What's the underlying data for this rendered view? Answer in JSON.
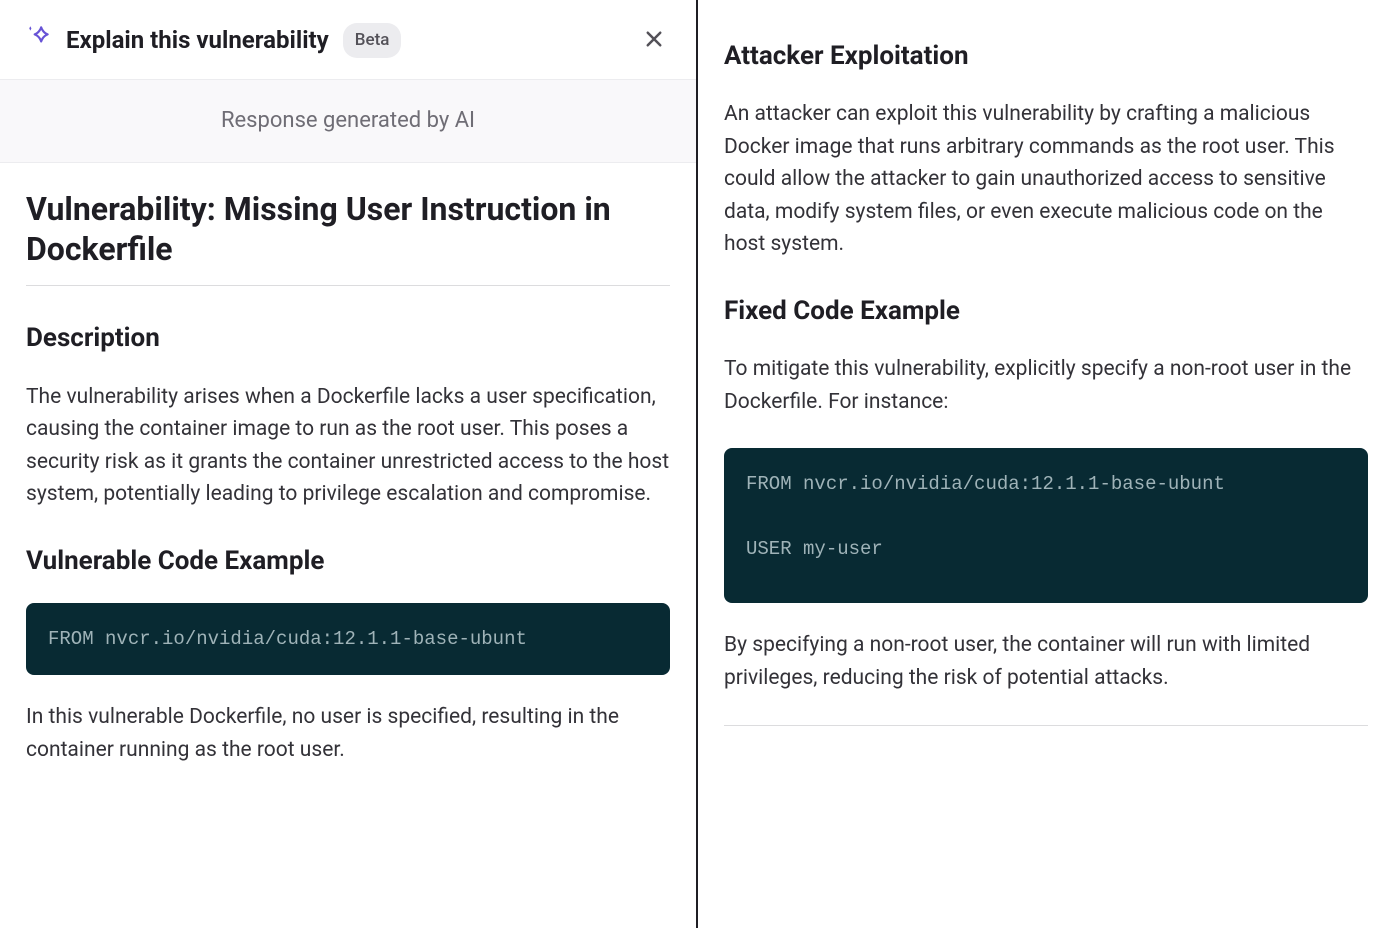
{
  "header": {
    "title": "Explain this vulnerability",
    "badge": "Beta"
  },
  "ai_banner": "Response generated by AI",
  "vulnerability": {
    "title": "Vulnerability: Missing User Instruction in Dockerfile",
    "description_heading": "Description",
    "description_body": "The vulnerability arises when a Dockerfile lacks a user specification, causing the container image to run as the root user. This poses a security risk as it grants the container unrestricted access to the host system, potentially leading to privilege escalation and compromise.",
    "vuln_code_heading": "Vulnerable Code Example",
    "vuln_code": "FROM nvcr.io/nvidia/cuda:12.1.1-base-ubunt",
    "vuln_code_after": "In this vulnerable Dockerfile, no user is specified, resulting in the container running as the root user.",
    "attacker_heading": "Attacker Exploitation",
    "attacker_body": "An attacker can exploit this vulnerability by crafting a malicious Docker image that runs arbitrary commands as the root user. This could allow the attacker to gain unauthorized access to sensitive data, modify system files, or even execute malicious code on the host system.",
    "fixed_heading": "Fixed Code Example",
    "fixed_intro": "To mitigate this vulnerability, explicitly specify a non-root user in the Dockerfile. For instance:",
    "fixed_code": "FROM nvcr.io/nvidia/cuda:12.1.1-base-ubunt\n\nUSER my-user",
    "fixed_after": "By specifying a non-root user, the container will run with limited privileges, reducing the risk of potential attacks."
  }
}
